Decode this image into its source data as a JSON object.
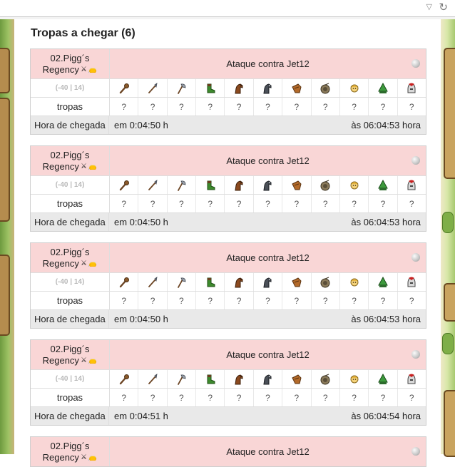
{
  "page": {
    "title": "Tropas a chegar (6)"
  },
  "labels": {
    "arrival": "Hora de chegada",
    "troops": "tropas",
    "coords": "(-40 | 14)"
  },
  "unit_icons": [
    "club-icon",
    "spear-icon",
    "axe-icon",
    "scout-boot-icon",
    "paladin-horse-icon",
    "theutates-horse-icon",
    "ram-icon",
    "catapult-icon",
    "chief-icon",
    "settler-icon",
    "hero-icon"
  ],
  "attacks": [
    {
      "village_line1": "02.Pigg´s",
      "village_line2": "Regency",
      "header": "Ataque contra Jet12",
      "counts": [
        "?",
        "?",
        "?",
        "?",
        "?",
        "?",
        "?",
        "?",
        "?",
        "?",
        "?"
      ],
      "in": "em 0:04:50 h",
      "at": "às 06:04:53 hora"
    },
    {
      "village_line1": "02.Pigg´s",
      "village_line2": "Regency",
      "header": "Ataque contra Jet12",
      "counts": [
        "?",
        "?",
        "?",
        "?",
        "?",
        "?",
        "?",
        "?",
        "?",
        "?",
        "?"
      ],
      "in": "em 0:04:50 h",
      "at": "às 06:04:53 hora"
    },
    {
      "village_line1": "02.Pigg´s",
      "village_line2": "Regency",
      "header": "Ataque contra Jet12",
      "counts": [
        "?",
        "?",
        "?",
        "?",
        "?",
        "?",
        "?",
        "?",
        "?",
        "?",
        "?"
      ],
      "in": "em 0:04:50 h",
      "at": "às 06:04:53 hora"
    },
    {
      "village_line1": "02.Pigg´s",
      "village_line2": "Regency",
      "header": "Ataque contra Jet12",
      "counts": [
        "?",
        "?",
        "?",
        "?",
        "?",
        "?",
        "?",
        "?",
        "?",
        "?",
        "?"
      ],
      "in": "em 0:04:51 h",
      "at": "às 06:04:54 hora"
    },
    {
      "village_line1": "02.Pigg´s",
      "village_line2": "Regency",
      "header": "Ataque contra Jet12"
    }
  ]
}
